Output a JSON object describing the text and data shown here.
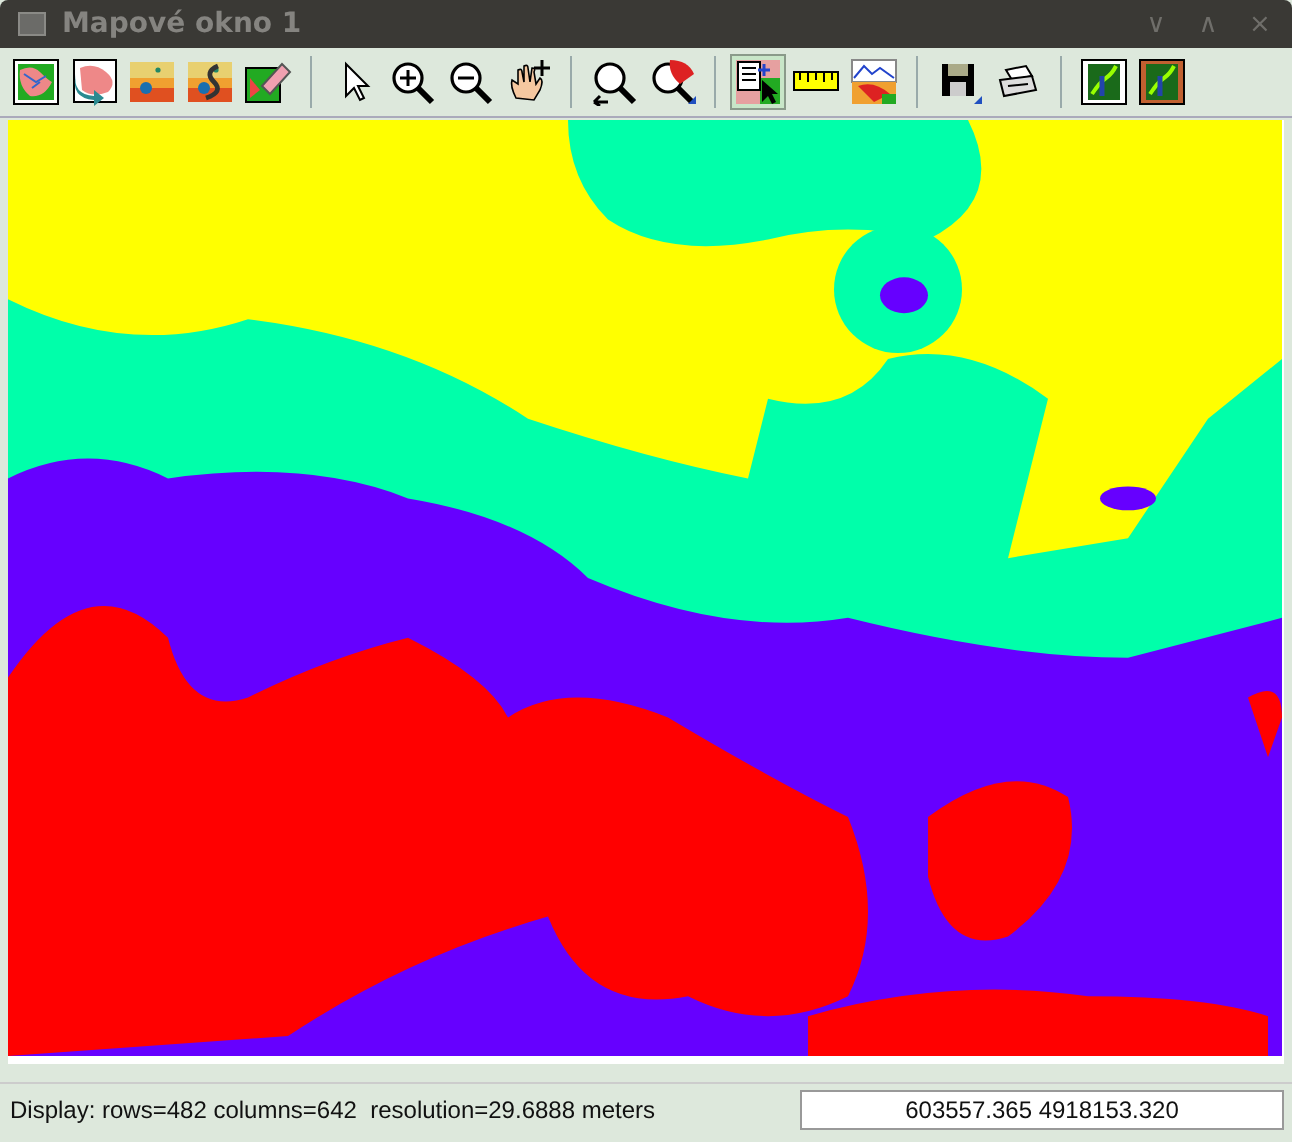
{
  "window": {
    "title": "Mapové okno 1",
    "controls": [
      "∨",
      "∧",
      "×"
    ]
  },
  "toolbar": [
    [
      {
        "kind": "display",
        "selected": false
      },
      {
        "kind": "redraw",
        "selected": false
      },
      {
        "kind": "overlay",
        "selected": false
      },
      {
        "kind": "vector",
        "selected": false
      },
      {
        "kind": "erase",
        "selected": false
      }
    ],
    [
      {
        "kind": "pointer",
        "selected": false
      },
      {
        "kind": "zoom-in",
        "selected": false
      },
      {
        "kind": "zoom-out",
        "selected": false
      },
      {
        "kind": "pan",
        "selected": false
      }
    ],
    [
      {
        "kind": "zoom-back",
        "selected": false
      },
      {
        "kind": "zoom-menu",
        "selected": false
      }
    ],
    [
      {
        "kind": "query",
        "selected": true
      },
      {
        "kind": "measure",
        "selected": false
      },
      {
        "kind": "profile",
        "selected": false
      }
    ],
    [
      {
        "kind": "save",
        "selected": false
      },
      {
        "kind": "print",
        "selected": false
      }
    ],
    [
      {
        "kind": "decor",
        "selected": false
      },
      {
        "kind": "decor-map",
        "selected": false
      }
    ]
  ],
  "status_bar": {
    "text": "Display: rows=482 columns=642  resolution=29.6888 meters",
    "coordinates": "603557.365 4918153.320"
  }
}
